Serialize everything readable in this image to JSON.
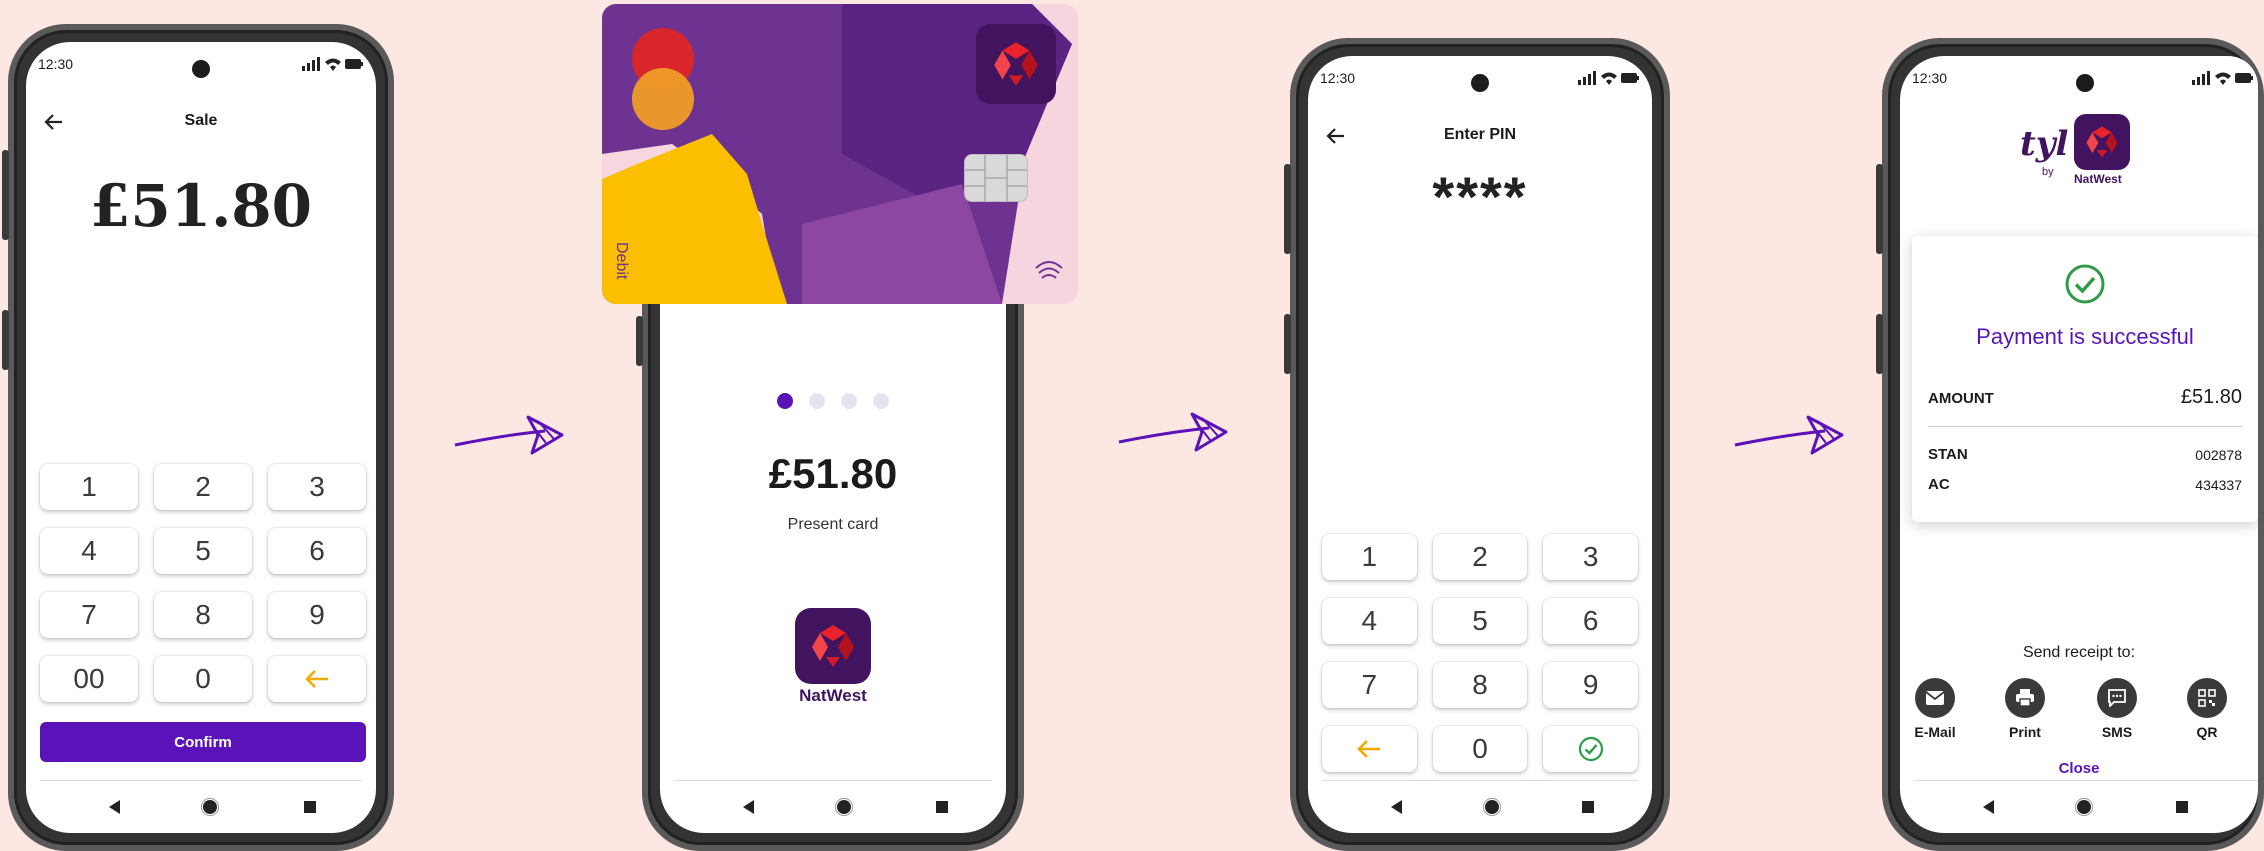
{
  "colors": {
    "purple": "#5a13b8",
    "yellow": "#f2a900",
    "green": "#2e9b47",
    "natwest_red": "#d01c26",
    "natwest_purple": "#42145f"
  },
  "status_time": "12:30",
  "screen1": {
    "title": "Sale",
    "amount": "£51.80",
    "keys": [
      "1",
      "2",
      "3",
      "4",
      "5",
      "6",
      "7",
      "8",
      "9",
      "00",
      "0"
    ],
    "confirm_label": "Confirm"
  },
  "screen2": {
    "card_label": "Debit",
    "amount": "£51.80",
    "prompt": "Present card",
    "bank_name": "NatWest",
    "carousel": {
      "count": 4,
      "active_index": 0
    }
  },
  "screen3": {
    "title": "Enter PIN",
    "pin_mask": "****",
    "keys": [
      "1",
      "2",
      "3",
      "4",
      "5",
      "6",
      "7",
      "8",
      "9",
      "0"
    ]
  },
  "screen4": {
    "brand": "tyl",
    "brand_by": "by",
    "brand_bank": "NatWest",
    "success_title": "Payment is successful",
    "amount_label": "AMOUNT",
    "amount_value": "£51.80",
    "stan_label": "STAN",
    "stan_value": "002878",
    "ac_label": "AC",
    "ac_value": "434337",
    "receipt_prompt": "Send receipt to:",
    "receipt_options": [
      "E-Mail",
      "Print",
      "SMS",
      "QR"
    ],
    "close_label": "Close"
  }
}
